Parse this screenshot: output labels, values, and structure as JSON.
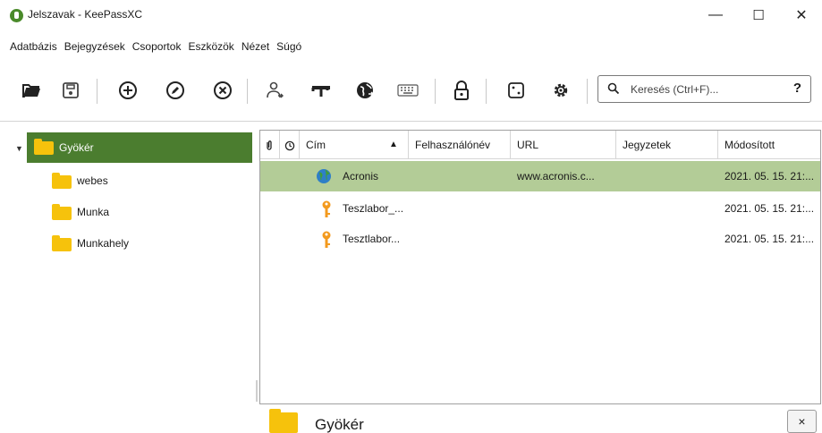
{
  "window": {
    "title": "Jelszavak - KeePassXC",
    "minimize": "—",
    "maximize": "☐",
    "close": "✕"
  },
  "menu": [
    "Adatbázis",
    "Bejegyzések",
    "Csoportok",
    "Eszközök",
    "Nézet",
    "Súgó"
  ],
  "toolbar": {
    "icons": [
      "open-folder-icon",
      "save-icon",
      "add-entry-icon",
      "edit-entry-icon",
      "delete-entry-icon",
      "copy-username-icon",
      "copy-password-icon",
      "open-url-icon",
      "autotype-keyboard-icon",
      "lock-icon",
      "password-generator-icon",
      "settings-icon"
    ],
    "search_placeholder": "Keresés (Ctrl+F)...",
    "help_label": "?"
  },
  "groups": {
    "root": "Gyökér",
    "children": [
      "webes",
      "Munka",
      "Munkahely"
    ]
  },
  "table": {
    "columns": [
      "",
      "",
      "Cím",
      "Felhasználónév",
      "URL",
      "Jegyzetek",
      "Módosított"
    ],
    "sort_indicator": "▲",
    "rows": [
      {
        "title": "Acronis",
        "username": "",
        "url": "www.acronis.c...",
        "notes": "",
        "modified": "2021. 05. 15. 21:...",
        "icon": "globe-icon",
        "selected": true
      },
      {
        "title": "Teszlabor_...",
        "username": "",
        "url": "",
        "notes": "",
        "modified": "2021. 05. 15. 21:...",
        "icon": "key-icon",
        "selected": false
      },
      {
        "title": "Tesztlabor...",
        "username": "",
        "url": "",
        "notes": "",
        "modified": "2021. 05. 15. 21:...",
        "icon": "key-icon",
        "selected": false
      }
    ]
  },
  "preview": {
    "title": "Gyökér",
    "close_label": "×"
  },
  "colors": {
    "selection_dark": "#4b7d2f",
    "selection_light": "#b3cc97",
    "folder": "#f6c20c",
    "key": "#f39a1e"
  }
}
